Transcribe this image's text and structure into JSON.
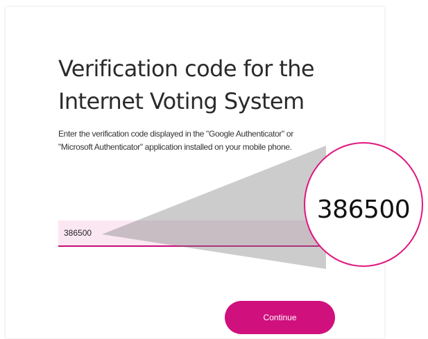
{
  "page": {
    "title_line1": "Verification code for the",
    "title_line2": "Internet Voting System",
    "description": "Enter the verification code displayed in the \"Google Authenticator\" or \"Microsoft Authenticator\" application installed on your mobile phone."
  },
  "form": {
    "code_value": "386500",
    "continue_label": "Continue"
  },
  "callout": {
    "magnified_text": "386500"
  },
  "colors": {
    "accent": "#d0107d",
    "input_background": "#fbe7f2",
    "callout_border": "#e0157f"
  }
}
